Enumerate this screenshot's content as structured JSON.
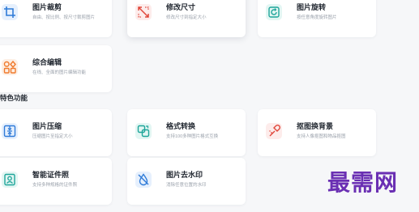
{
  "tools": [
    {
      "title": "图片裁剪",
      "desc": "自由、按比例、按尺寸裁剪图片",
      "icon": "crop-icon"
    },
    {
      "title": "修改尺寸",
      "desc": "修改尺寸到指定大小",
      "icon": "resize-icon"
    },
    {
      "title": "图片旋转",
      "desc": "按任意角度旋转图片",
      "icon": "rotate-icon"
    },
    {
      "title": "综合编辑",
      "desc": "在线、全面的图片编辑功能",
      "icon": "edit-grid-icon"
    }
  ],
  "section_title": "特色功能",
  "features": [
    {
      "title": "图片压缩",
      "desc": "压缩图片至指定大小",
      "icon": "compress-icon"
    },
    {
      "title": "格式转换",
      "desc": "支持100多种图片格式互换",
      "icon": "convert-icon"
    },
    {
      "title": "抠图换背景",
      "desc": "支持人像抠图和物品抠图",
      "icon": "cutout-icon"
    },
    {
      "title": "智能证件照",
      "desc": "支持多种规格的证件照",
      "icon": "id-photo-icon"
    },
    {
      "title": "图片去水印",
      "desc": "消除任意位置的水印",
      "icon": "remove-watermark-icon"
    }
  ],
  "watermark": "最需网",
  "colors": {
    "blue": "#2f7bd8",
    "blue_bg": "#e6f0fd",
    "red": "#e0463a",
    "red_bg": "#fdeceb",
    "teal": "#1ea59a",
    "teal_bg": "#e3f6f3",
    "orange": "#f07a2c",
    "orange_bg": "#fdefe4",
    "watermark": "#6a2fb3"
  }
}
